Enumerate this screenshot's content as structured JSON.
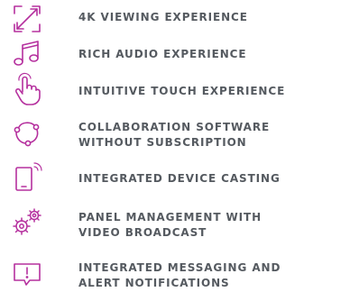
{
  "features": [
    {
      "icon": "expand-arrows-icon",
      "lines": [
        "4K VIEWING EXPERIENCE"
      ]
    },
    {
      "icon": "music-note-icon",
      "lines": [
        "RICH AUDIO EXPERIENCE"
      ]
    },
    {
      "icon": "touch-hand-icon",
      "lines": [
        "INTUITIVE TOUCH EXPERIENCE"
      ]
    },
    {
      "icon": "collaboration-network-icon",
      "lines": [
        "COLLABORATION SOFTWARE",
        "WITHOUT SUBSCRIPTION"
      ]
    },
    {
      "icon": "device-casting-icon",
      "lines": [
        "INTEGRATED DEVICE CASTING"
      ]
    },
    {
      "icon": "gears-icon",
      "lines": [
        "PANEL MANAGEMENT WITH",
        "VIDEO BROADCAST"
      ]
    },
    {
      "icon": "alert-message-icon",
      "lines": [
        "INTEGRATED MESSAGING AND",
        "ALERT NOTIFICATIONS"
      ]
    }
  ],
  "colors": {
    "icon": "#b5309e",
    "text": "#555a60"
  }
}
